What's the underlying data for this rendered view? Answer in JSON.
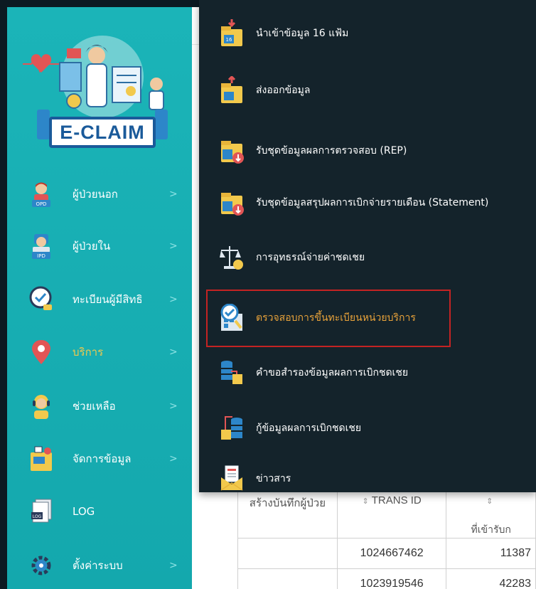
{
  "logo": {
    "text": "E-CLAIM"
  },
  "sidebar": {
    "items": [
      {
        "label": "ผู้ป่วยนอก",
        "icon": "opd-patient-icon",
        "icon_text": "OPD",
        "has_chevron": true,
        "active": false
      },
      {
        "label": "ผู้ป่วยใน",
        "icon": "ipd-patient-icon",
        "icon_text": "IPD",
        "has_chevron": true,
        "active": false
      },
      {
        "label": "ทะเบียนผู้มีสิทธิ",
        "icon": "registry-check-icon",
        "has_chevron": true,
        "active": false
      },
      {
        "label": "บริการ",
        "icon": "location-pin-icon",
        "has_chevron": true,
        "active": true
      },
      {
        "label": "ช่วยเหลือ",
        "icon": "helpdesk-icon",
        "has_chevron": true,
        "active": false
      },
      {
        "label": "จัดการข้อมูล",
        "icon": "data-manage-icon",
        "has_chevron": true,
        "active": false
      },
      {
        "label": "LOG",
        "icon": "log-file-icon",
        "icon_text": "LOG",
        "has_chevron": false,
        "active": false
      },
      {
        "label": "ตั้งค่าระบบ",
        "icon": "settings-gear-icon",
        "has_chevron": true,
        "active": false
      }
    ],
    "chevron": ">"
  },
  "dropdown": {
    "items": [
      {
        "label": "นำเข้าข้อมูล 16 แฟ้ม",
        "icon": "import-16-files-icon",
        "icon_text": "16"
      },
      {
        "label": "ส่งออกข้อมูล",
        "icon": "export-data-icon"
      },
      {
        "label": "รับชุดข้อมูลผลการตรวจสอบ (REP)",
        "icon": "receive-rep-icon"
      },
      {
        "label": "รับชุดข้อมูลสรุปผลการเบิกจ่ายรายเดือน (Statement)",
        "icon": "receive-statement-icon"
      },
      {
        "label": "การอุทธรณ์จ่ายค่าชดเชย",
        "icon": "appeal-scale-icon"
      },
      {
        "label": "ตรวจสอบการขึ้นทะเบียนหน่วยบริการ",
        "icon": "verify-registration-icon",
        "highlighted": true
      },
      {
        "label": "คำขอสำรองข้อมูลผลการเบิกชดเชย",
        "icon": "backup-request-icon"
      },
      {
        "label": "กู้ข้อมูลผลการเบิกชดเชย",
        "icon": "restore-data-icon"
      },
      {
        "label": "ข่าวสาร",
        "icon": "news-mail-icon"
      }
    ]
  },
  "table": {
    "headers": [
      "สร้างบันทึกผู้ป่วย",
      "TRANS ID",
      "ที่เข้ารับก"
    ],
    "sort_glyph": "⇕",
    "rows": [
      [
        "",
        "1024667462",
        "11387"
      ],
      [
        "",
        "1023919546",
        "42283"
      ]
    ]
  },
  "colors": {
    "sidebar": "#17aeb3",
    "dropdown": "#14232b",
    "highlight_border": "#c42323",
    "highlight_text": "#e8a23a",
    "active_text": "#f2c94c"
  }
}
